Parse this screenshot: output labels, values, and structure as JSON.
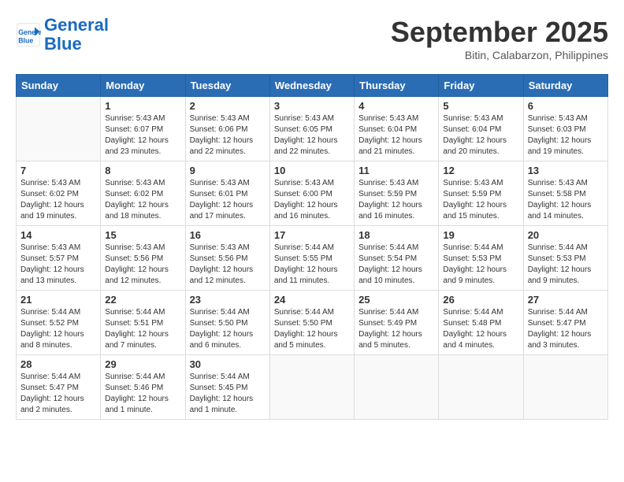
{
  "header": {
    "logo_line1": "General",
    "logo_line2": "Blue",
    "month": "September 2025",
    "location": "Bitin, Calabarzon, Philippines"
  },
  "weekdays": [
    "Sunday",
    "Monday",
    "Tuesday",
    "Wednesday",
    "Thursday",
    "Friday",
    "Saturday"
  ],
  "weeks": [
    [
      {
        "day": "",
        "info": ""
      },
      {
        "day": "1",
        "info": "Sunrise: 5:43 AM\nSunset: 6:07 PM\nDaylight: 12 hours\nand 23 minutes."
      },
      {
        "day": "2",
        "info": "Sunrise: 5:43 AM\nSunset: 6:06 PM\nDaylight: 12 hours\nand 22 minutes."
      },
      {
        "day": "3",
        "info": "Sunrise: 5:43 AM\nSunset: 6:05 PM\nDaylight: 12 hours\nand 22 minutes."
      },
      {
        "day": "4",
        "info": "Sunrise: 5:43 AM\nSunset: 6:04 PM\nDaylight: 12 hours\nand 21 minutes."
      },
      {
        "day": "5",
        "info": "Sunrise: 5:43 AM\nSunset: 6:04 PM\nDaylight: 12 hours\nand 20 minutes."
      },
      {
        "day": "6",
        "info": "Sunrise: 5:43 AM\nSunset: 6:03 PM\nDaylight: 12 hours\nand 19 minutes."
      }
    ],
    [
      {
        "day": "7",
        "info": "Sunrise: 5:43 AM\nSunset: 6:02 PM\nDaylight: 12 hours\nand 19 minutes."
      },
      {
        "day": "8",
        "info": "Sunrise: 5:43 AM\nSunset: 6:02 PM\nDaylight: 12 hours\nand 18 minutes."
      },
      {
        "day": "9",
        "info": "Sunrise: 5:43 AM\nSunset: 6:01 PM\nDaylight: 12 hours\nand 17 minutes."
      },
      {
        "day": "10",
        "info": "Sunrise: 5:43 AM\nSunset: 6:00 PM\nDaylight: 12 hours\nand 16 minutes."
      },
      {
        "day": "11",
        "info": "Sunrise: 5:43 AM\nSunset: 5:59 PM\nDaylight: 12 hours\nand 16 minutes."
      },
      {
        "day": "12",
        "info": "Sunrise: 5:43 AM\nSunset: 5:59 PM\nDaylight: 12 hours\nand 15 minutes."
      },
      {
        "day": "13",
        "info": "Sunrise: 5:43 AM\nSunset: 5:58 PM\nDaylight: 12 hours\nand 14 minutes."
      }
    ],
    [
      {
        "day": "14",
        "info": "Sunrise: 5:43 AM\nSunset: 5:57 PM\nDaylight: 12 hours\nand 13 minutes."
      },
      {
        "day": "15",
        "info": "Sunrise: 5:43 AM\nSunset: 5:56 PM\nDaylight: 12 hours\nand 12 minutes."
      },
      {
        "day": "16",
        "info": "Sunrise: 5:43 AM\nSunset: 5:56 PM\nDaylight: 12 hours\nand 12 minutes."
      },
      {
        "day": "17",
        "info": "Sunrise: 5:44 AM\nSunset: 5:55 PM\nDaylight: 12 hours\nand 11 minutes."
      },
      {
        "day": "18",
        "info": "Sunrise: 5:44 AM\nSunset: 5:54 PM\nDaylight: 12 hours\nand 10 minutes."
      },
      {
        "day": "19",
        "info": "Sunrise: 5:44 AM\nSunset: 5:53 PM\nDaylight: 12 hours\nand 9 minutes."
      },
      {
        "day": "20",
        "info": "Sunrise: 5:44 AM\nSunset: 5:53 PM\nDaylight: 12 hours\nand 9 minutes."
      }
    ],
    [
      {
        "day": "21",
        "info": "Sunrise: 5:44 AM\nSunset: 5:52 PM\nDaylight: 12 hours\nand 8 minutes."
      },
      {
        "day": "22",
        "info": "Sunrise: 5:44 AM\nSunset: 5:51 PM\nDaylight: 12 hours\nand 7 minutes."
      },
      {
        "day": "23",
        "info": "Sunrise: 5:44 AM\nSunset: 5:50 PM\nDaylight: 12 hours\nand 6 minutes."
      },
      {
        "day": "24",
        "info": "Sunrise: 5:44 AM\nSunset: 5:50 PM\nDaylight: 12 hours\nand 5 minutes."
      },
      {
        "day": "25",
        "info": "Sunrise: 5:44 AM\nSunset: 5:49 PM\nDaylight: 12 hours\nand 5 minutes."
      },
      {
        "day": "26",
        "info": "Sunrise: 5:44 AM\nSunset: 5:48 PM\nDaylight: 12 hours\nand 4 minutes."
      },
      {
        "day": "27",
        "info": "Sunrise: 5:44 AM\nSunset: 5:47 PM\nDaylight: 12 hours\nand 3 minutes."
      }
    ],
    [
      {
        "day": "28",
        "info": "Sunrise: 5:44 AM\nSunset: 5:47 PM\nDaylight: 12 hours\nand 2 minutes."
      },
      {
        "day": "29",
        "info": "Sunrise: 5:44 AM\nSunset: 5:46 PM\nDaylight: 12 hours\nand 1 minute."
      },
      {
        "day": "30",
        "info": "Sunrise: 5:44 AM\nSunset: 5:45 PM\nDaylight: 12 hours\nand 1 minute."
      },
      {
        "day": "",
        "info": ""
      },
      {
        "day": "",
        "info": ""
      },
      {
        "day": "",
        "info": ""
      },
      {
        "day": "",
        "info": ""
      }
    ]
  ]
}
